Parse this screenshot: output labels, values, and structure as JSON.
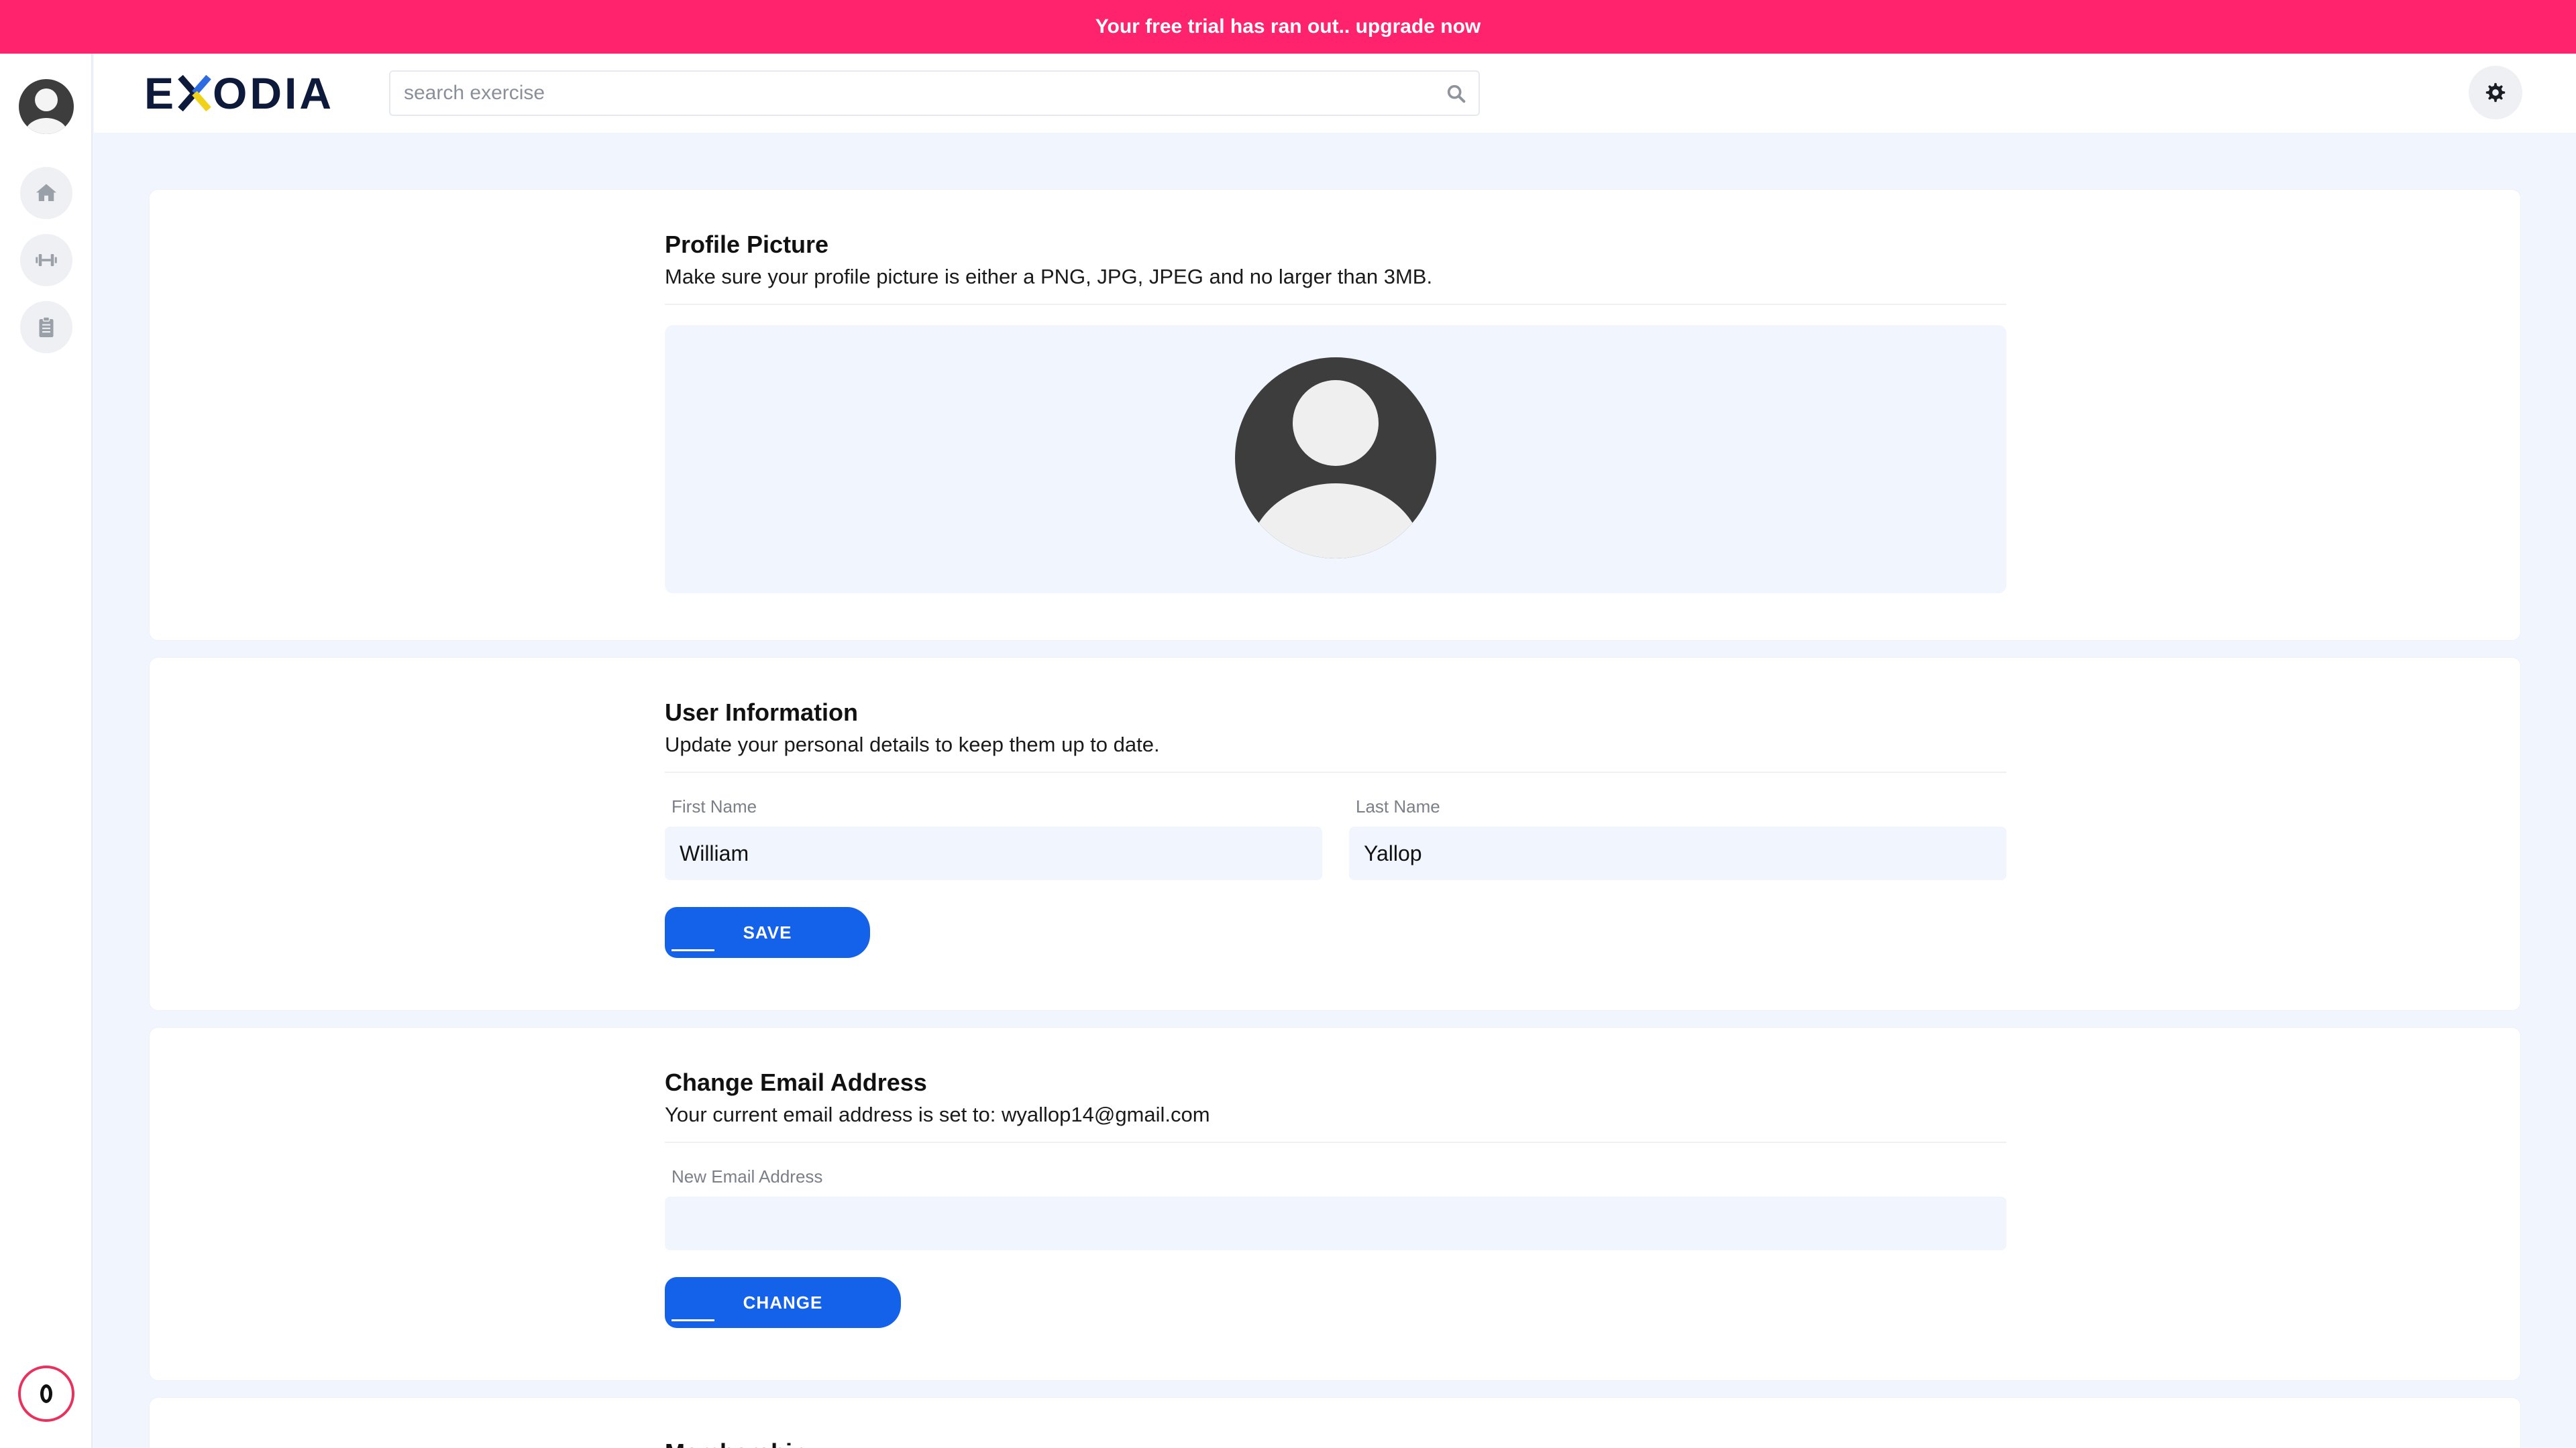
{
  "banner": {
    "text": "Your free trial has ran out.. upgrade now"
  },
  "sidebar": {
    "items": [
      {
        "icon": "home-icon"
      },
      {
        "icon": "dumbbell-icon"
      },
      {
        "icon": "clipboard-icon"
      }
    ],
    "bottom_badge": "0"
  },
  "header": {
    "logo_left": "E",
    "logo_right": "ODIA",
    "search_placeholder": "search exercise"
  },
  "profile_picture": {
    "title": "Profile Picture",
    "subtitle": "Make sure your profile picture is either a PNG, JPG, JPEG and no larger than 3MB."
  },
  "user_information": {
    "title": "User Information",
    "subtitle": "Update your personal details to keep them up to date.",
    "first_name_label": "First Name",
    "first_name_value": "William",
    "last_name_label": "Last Name",
    "last_name_value": "Yallop",
    "save_label": "SAVE"
  },
  "change_email": {
    "title": "Change Email Address",
    "subtitle": "Your current email address is set to: wyallop14@gmail.com",
    "new_email_label": "New Email Address",
    "new_email_value": "",
    "change_label": "CHANGE"
  },
  "membership": {
    "title": "Membership"
  },
  "colors": {
    "banner": "#ff226d",
    "primary_button": "#1461ea",
    "page_background": "#f1f5fd",
    "logo": "#0d1a3b"
  }
}
